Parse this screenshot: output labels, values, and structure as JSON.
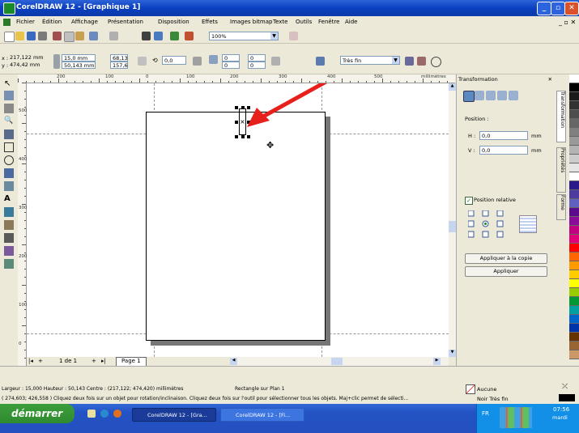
{
  "window": {
    "title": "CorelDRAW 12 - [Graphique 1]"
  },
  "menu": [
    "Fichier",
    "Édition",
    "Affichage",
    "Présentation",
    "Disposition",
    "Effets",
    "Images bitmap",
    "Texte",
    "Outils",
    "Fenêtre",
    "Aide"
  ],
  "toolbar": {
    "zoom_value": "100%"
  },
  "propbar": {
    "x_value": "217,122 mm",
    "y_value": "474,42 mm",
    "width_value": "15,0 mm",
    "height_value": "50,143 mm",
    "scale_w": "68,13",
    "scale_h": "157,6",
    "rotation_value": "0,0",
    "pos_a": "0",
    "pos_b": "0",
    "pos_c": "0",
    "pos_d": "0",
    "outline_width": "Très fin"
  },
  "ruler": {
    "unit": "millimètres",
    "h_labels": [
      "200",
      "100",
      "0",
      "100",
      "200",
      "300",
      "400",
      "500"
    ],
    "v_labels": [
      "500",
      "400",
      "300",
      "200",
      "100",
      "0"
    ]
  },
  "page_nav": {
    "counter": "1 de 1",
    "tab": "Page 1"
  },
  "docker": {
    "title": "Transformation",
    "position_label": "Position :",
    "h_label": "H :",
    "h_value": "0,0",
    "v_label": "V :",
    "v_value": "0,0",
    "unit": "mm",
    "relative_label": "Position relative",
    "copy_button": "Appliquer à la copie",
    "apply_button": "Appliquer",
    "tabs": [
      "Transformation",
      "Propriétés",
      "Forme"
    ]
  },
  "status": {
    "line1": "Largeur : 15,000  Hauteur : 50,143  Centre : (217,122; 474,420)  millimètres",
    "object": "Rectangle sur Plan 1",
    "line2": "( 274,603; 426,558 )   Cliquez deux fois sur un objet pour rotation/inclinaison. Cliquez deux fois sur l'outil pour sélectionner tous les objets. Maj+clic permet de sélecti...",
    "fill": "Aucune",
    "outline": "Noir  Très fin"
  },
  "taskbar": {
    "start": "démarrer",
    "tasks": [
      "CorelDRAW 12 - [Gra...",
      "CorelDRAW 12 - [Fi..."
    ],
    "lang": "FR",
    "time": "07:56",
    "day": "mardi"
  },
  "colors": {
    "title_bar": "#0a3fc0",
    "arrow": "#e8201c",
    "start_button": "#2f8a2f",
    "tray": "#1290e8"
  },
  "palette": [
    "#ffffff",
    "#000000",
    "#1a1a1a",
    "#333333",
    "#4d4d4d",
    "#666666",
    "#808080",
    "#999999",
    "#b3b3b3",
    "#cccccc",
    "#e5e5e5",
    "#ffffff",
    "#2a1a8a",
    "#4e3ba0",
    "#6060c0",
    "#5a0a8a",
    "#8a0a9a",
    "#c00080",
    "#e0007a",
    "#ff0000",
    "#ff6600",
    "#ff9900",
    "#ffcc00",
    "#ffff00",
    "#99cc00",
    "#009933",
    "#00a0a0",
    "#0066cc",
    "#0033aa",
    "#663300",
    "#996633",
    "#cc9966"
  ]
}
